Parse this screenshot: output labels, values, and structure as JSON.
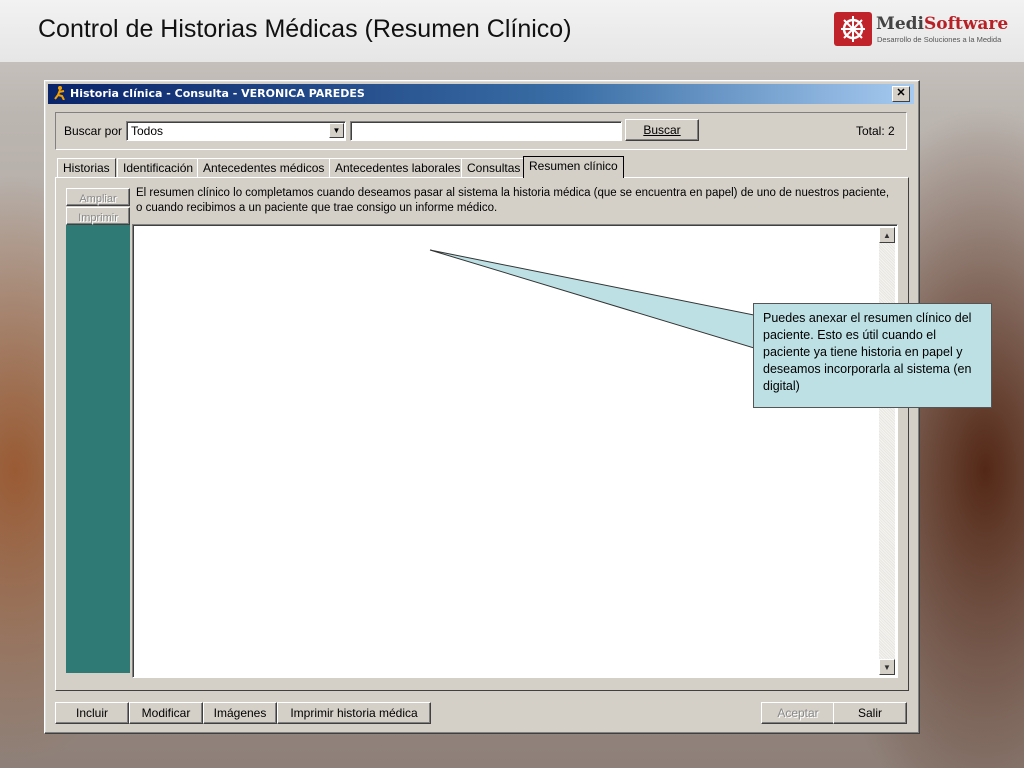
{
  "slide": {
    "title": "Control de Historias Médicas (Resumen Clínico)",
    "logo": {
      "name_a": "Medi",
      "name_b": "Software",
      "tagline": "Desarrollo de Soluciones a la Medida"
    }
  },
  "window": {
    "title": "Historia clínica - Consulta - VERONICA PAREDES",
    "close_symbol": "✕"
  },
  "search": {
    "label": "Buscar por",
    "by_value": "Todos",
    "query": "",
    "button": "Buscar",
    "total": "Total: 2"
  },
  "tabs": [
    "Historias",
    "Identificación",
    "Antecedentes médicos",
    "Antecedentes laborales",
    "Consultas",
    "Resumen clínico"
  ],
  "active_tab": "Resumen clínico",
  "panel": {
    "side_buttons": [
      "Ampliar",
      "Imprimir"
    ],
    "info": "El resumen clínico lo completamos cuando deseamos pasar al sistema la historia médica (que se encuentra en papel) de uno de nuestros paciente, o cuando recibimos a un paciente que trae consigo un informe médico.",
    "memo": ""
  },
  "actions": {
    "left": [
      "Incluir",
      "Modificar",
      "Imágenes",
      "Imprimir historia médica"
    ],
    "accept": "Aceptar",
    "exit": "Salir"
  },
  "callout": "Puedes anexar el resumen clínico del paciente. Esto es útil cuando el paciente ya tiene historia en papel y deseamos incorporarla al sistema (en digital)",
  "colors": {
    "side_panel": "#2f7a74",
    "callout_fill": "#bde0e4",
    "titlebar": "#0a246a"
  },
  "icons": [
    "app-icon",
    "close-icon",
    "dropdown-arrow-icon",
    "scroll-up-icon",
    "scroll-down-icon",
    "logo-icon"
  ]
}
